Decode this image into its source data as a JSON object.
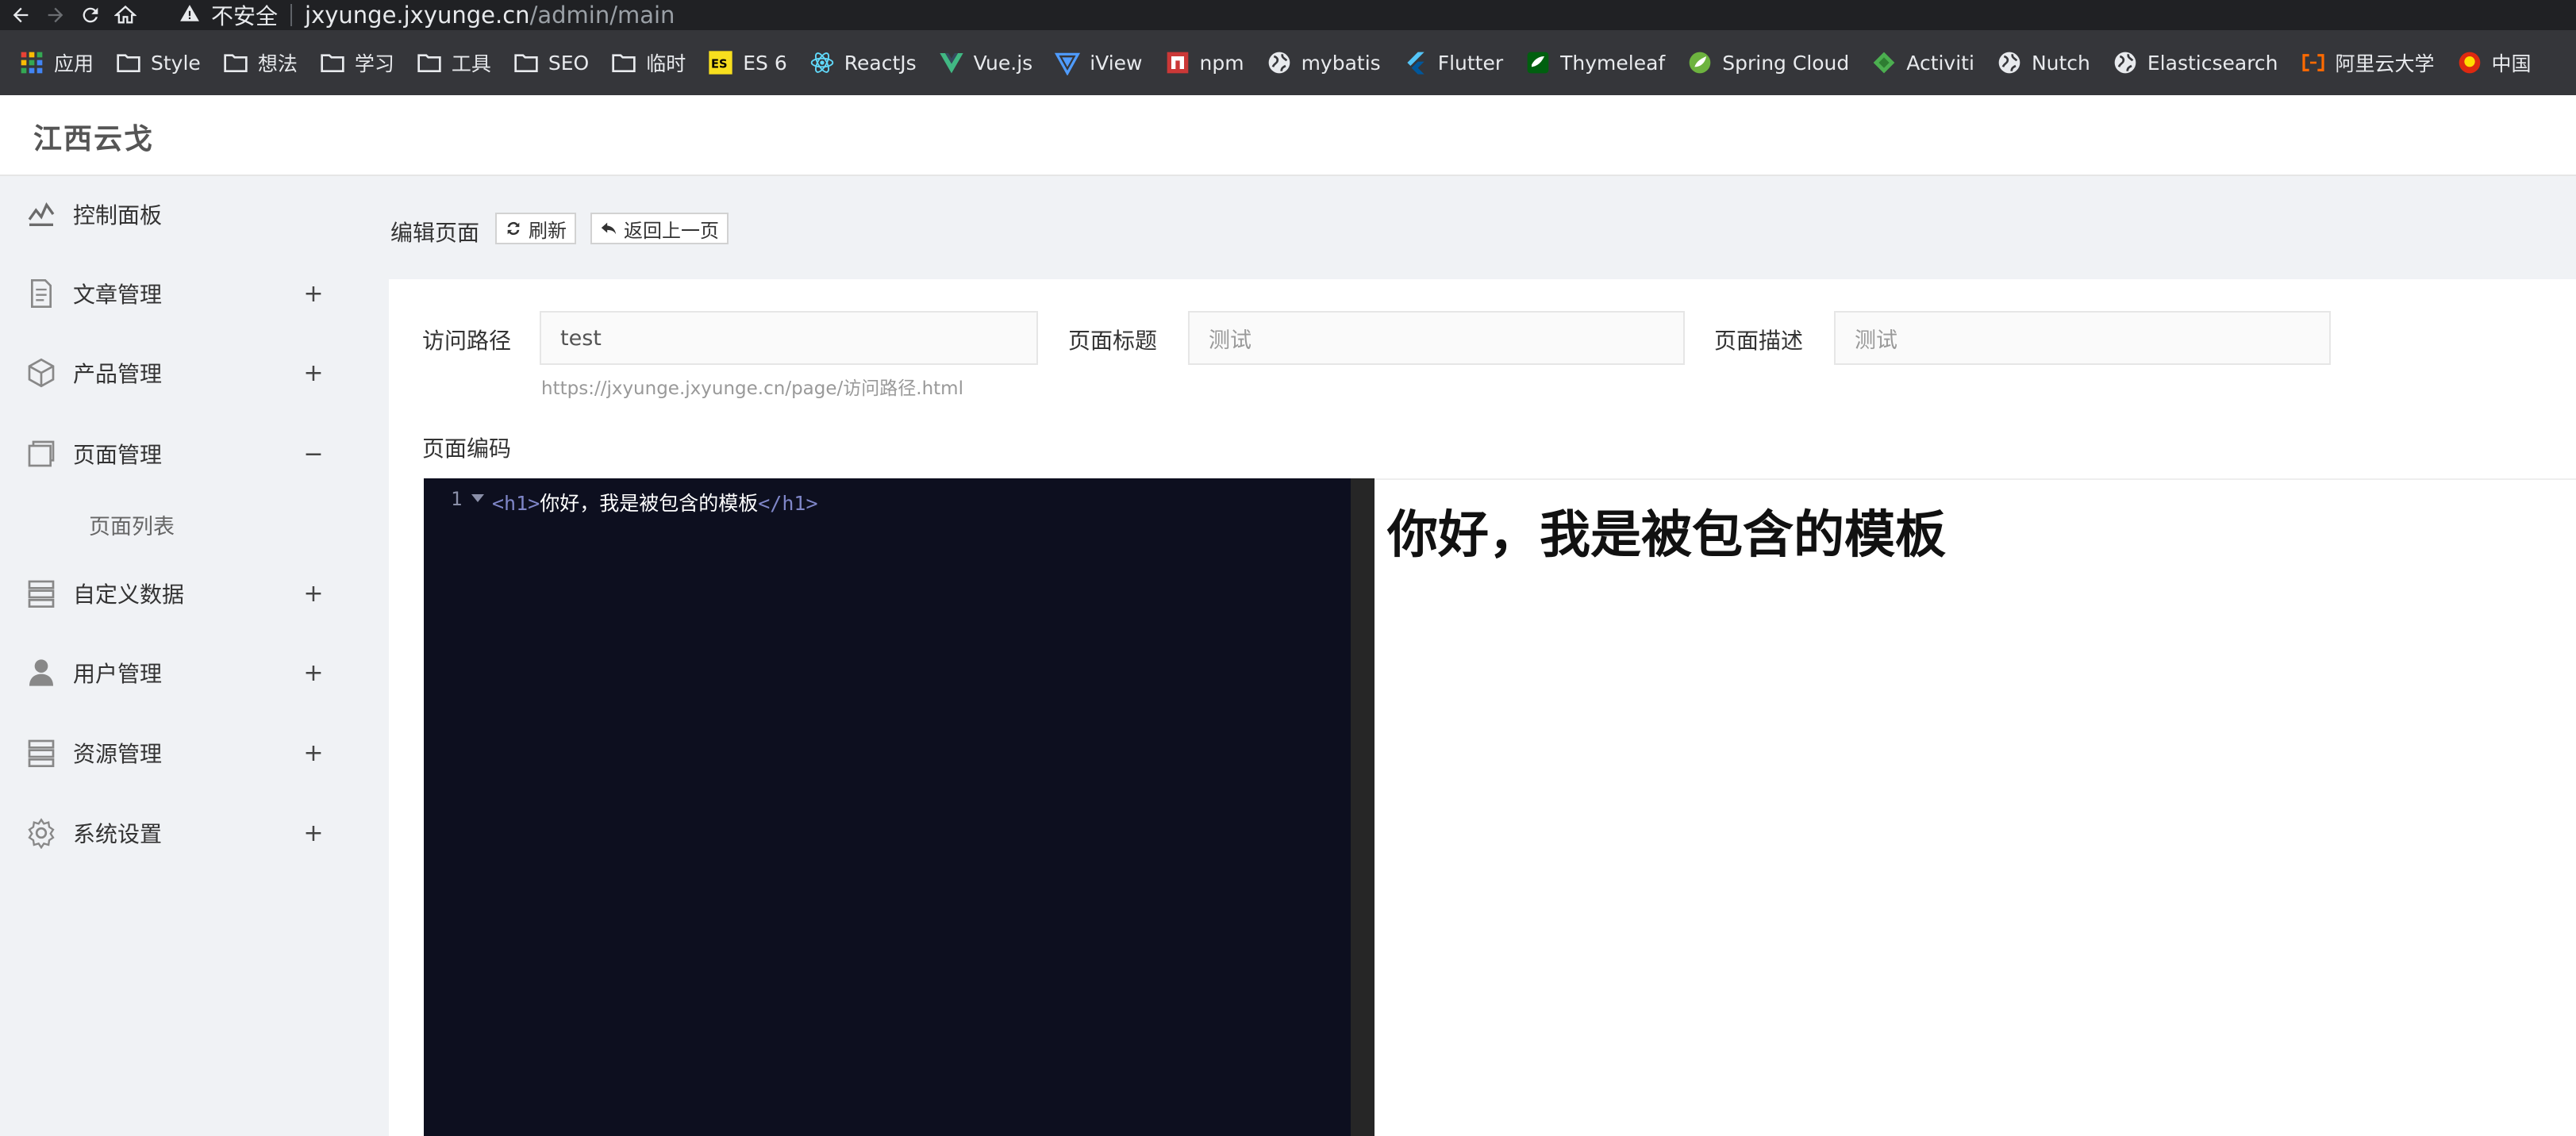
{
  "browser": {
    "security_label": "不安全",
    "url_host": "jxyunge.jxyunge.cn",
    "url_path": "/admin/main",
    "bookmarks": [
      {
        "label": "应用",
        "icon": "apps-grid-icon"
      },
      {
        "label": "Style",
        "icon": "folder-icon"
      },
      {
        "label": "想法",
        "icon": "folder-icon"
      },
      {
        "label": "学习",
        "icon": "folder-icon"
      },
      {
        "label": "工具",
        "icon": "folder-icon"
      },
      {
        "label": "SEO",
        "icon": "folder-icon"
      },
      {
        "label": "临时",
        "icon": "folder-icon"
      },
      {
        "label": "ES 6",
        "icon": "es-icon"
      },
      {
        "label": "ReactJs",
        "icon": "react-icon"
      },
      {
        "label": "Vue.js",
        "icon": "vue-icon"
      },
      {
        "label": "iView",
        "icon": "iview-icon"
      },
      {
        "label": "npm",
        "icon": "npm-icon"
      },
      {
        "label": "mybatis",
        "icon": "globe-icon"
      },
      {
        "label": "Flutter",
        "icon": "flutter-icon"
      },
      {
        "label": "Thymeleaf",
        "icon": "thymeleaf-icon"
      },
      {
        "label": "Spring Cloud",
        "icon": "spring-icon"
      },
      {
        "label": "Activiti",
        "icon": "activiti-icon"
      },
      {
        "label": "Nutch",
        "icon": "globe-icon"
      },
      {
        "label": "Elasticsearch",
        "icon": "globe-icon"
      },
      {
        "label": "阿里云大学",
        "icon": "aliyun-icon"
      },
      {
        "label": "中国",
        "icon": "emblem-icon"
      }
    ]
  },
  "app": {
    "brand": "江西云戈"
  },
  "sidebar": {
    "items": [
      {
        "label": "控制面板",
        "icon": "dashboard-icon",
        "toggle": ""
      },
      {
        "label": "文章管理",
        "icon": "document-icon",
        "toggle": "+"
      },
      {
        "label": "产品管理",
        "icon": "box-icon",
        "toggle": "+"
      },
      {
        "label": "页面管理",
        "icon": "pages-icon",
        "toggle": "−"
      },
      {
        "label": "自定义数据",
        "icon": "database-icon",
        "toggle": "+"
      },
      {
        "label": "用户管理",
        "icon": "user-icon",
        "toggle": "+"
      },
      {
        "label": "资源管理",
        "icon": "server-icon",
        "toggle": "+"
      },
      {
        "label": "系统设置",
        "icon": "gear-icon",
        "toggle": "+"
      }
    ],
    "sub_items": [
      {
        "label": "页面列表"
      }
    ]
  },
  "toolbar": {
    "title": "编辑页面",
    "refresh_label": "刷新",
    "back_label": "返回上一页"
  },
  "form": {
    "path_label": "访问路径",
    "path_value": "test",
    "path_hint": "https://jxyunge.jxyunge.cn/page/访问路径.html",
    "title_label": "页面标题",
    "title_placeholder": "测试",
    "desc_label": "页面描述",
    "desc_placeholder": "测试",
    "code_label": "页面编码"
  },
  "editor": {
    "line_number": "1",
    "open_tag": "<h1>",
    "content": "你好，我是被包含的模板",
    "close_tag": "</h1>"
  },
  "preview": {
    "heading": "你好，我是被包含的模板"
  }
}
